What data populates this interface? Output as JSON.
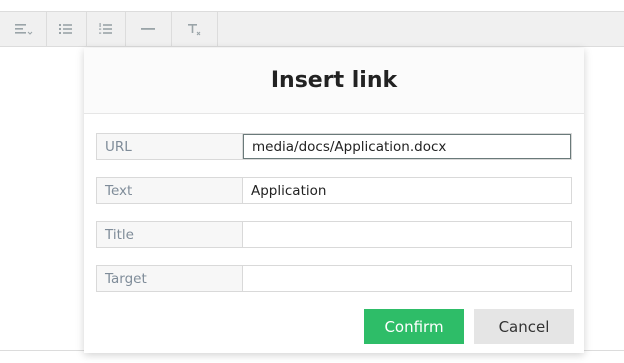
{
  "toolbar": {
    "buttons": [
      {
        "name": "align-icon"
      },
      {
        "name": "bulleted-list-icon"
      },
      {
        "name": "numbered-list-icon"
      },
      {
        "name": "horizontal-rule-icon"
      },
      {
        "name": "clear-format-icon"
      }
    ]
  },
  "dialog": {
    "title": "Insert link",
    "fields": {
      "url": {
        "label": "URL",
        "value": "media/docs/Application.docx"
      },
      "text": {
        "label": "Text",
        "value": "Application"
      },
      "title": {
        "label": "Title",
        "value": ""
      },
      "target": {
        "label": "Target",
        "value": ""
      }
    },
    "confirm_label": "Confirm",
    "cancel_label": "Cancel"
  },
  "colors": {
    "confirm_bg": "#2ebd68",
    "cancel_bg": "#e5e5e5",
    "label_text": "#7f8c99"
  }
}
